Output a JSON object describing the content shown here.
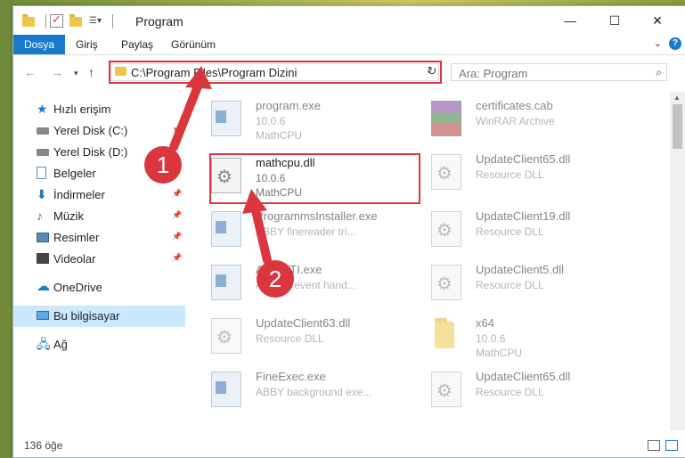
{
  "window": {
    "title": "Program",
    "controls": {
      "minimize": "—",
      "maximize": "☐",
      "close": "✕"
    }
  },
  "ribbon": {
    "tabs": [
      "Dosya",
      "Giriş",
      "Paylaş",
      "Görünüm"
    ]
  },
  "navigation": {
    "address": "C:\\Program Files\\Program Dizini",
    "search_placeholder": "Ara: Program"
  },
  "sidebar": {
    "items": [
      {
        "label": "Hızlı erişim",
        "icon": "star-icon",
        "pinned": false
      },
      {
        "label": "Yerel Disk (C:)",
        "icon": "disk-icon",
        "pinned": true
      },
      {
        "label": "Yerel Disk (D:)",
        "icon": "disk-icon",
        "pinned": true
      },
      {
        "label": "Belgeler",
        "icon": "document-icon",
        "pinned": true
      },
      {
        "label": "İndirmeler",
        "icon": "download-icon",
        "pinned": true
      },
      {
        "label": "Müzik",
        "icon": "music-icon",
        "pinned": true
      },
      {
        "label": "Resimler",
        "icon": "pictures-icon",
        "pinned": true
      },
      {
        "label": "Videolar",
        "icon": "videos-icon",
        "pinned": true
      },
      {
        "label": "OneDrive",
        "icon": "cloud-icon",
        "pinned": false
      },
      {
        "label": "Bu bilgisayar",
        "icon": "computer-icon",
        "pinned": false,
        "selected": true
      },
      {
        "label": "Ağ",
        "icon": "network-icon",
        "pinned": false
      }
    ]
  },
  "files": [
    {
      "name": "program.exe",
      "line2": "10.0.6",
      "line3": "MathCPU",
      "icon": "exe-icon"
    },
    {
      "name": "certificates.cab",
      "line2": "WinRAR Archive",
      "line3": "",
      "icon": "rar-icon"
    },
    {
      "name": "mathcpu.dll",
      "line2": "10.0.6",
      "line3": "MathCPU",
      "icon": "dll-icon"
    },
    {
      "name": "UpdateClient65.dll",
      "line2": "Resource DLL",
      "line3": "",
      "icon": "dll-icon"
    },
    {
      "name": "ProgrammsInstaller.exe",
      "line2": "ABBY finereader tri...",
      "line3": "",
      "icon": "exe-icon"
    },
    {
      "name": "UpdateClient19.dll",
      "line2": "Resource DLL",
      "line3": "",
      "icon": "dll-icon"
    },
    {
      "name": "AbbySTI.exe",
      "line2": "ABBYS event hand...",
      "line3": "",
      "icon": "exe-icon"
    },
    {
      "name": "UpdateClient5.dll",
      "line2": "Resource DLL",
      "line3": "",
      "icon": "dll-icon"
    },
    {
      "name": "UpdateClient63.dll",
      "line2": "Resource DLL",
      "line3": "",
      "icon": "dll-icon"
    },
    {
      "name": "x64",
      "line2": "10.0.6",
      "line3": "MathCPU",
      "icon": "folder-icon"
    },
    {
      "name": "FineExec.exe",
      "line2": "ABBY background exe...",
      "line3": "",
      "icon": "exe-icon"
    },
    {
      "name": "UpdateClient65.dll",
      "line2": "Resource DLL",
      "line3": "",
      "icon": "dll-icon"
    }
  ],
  "status": {
    "item_count": "136 öğe"
  },
  "callouts": [
    "1",
    "2"
  ],
  "colors": {
    "accent": "#1979ca",
    "highlight": "#d9363e",
    "selection": "#cce8ff"
  }
}
